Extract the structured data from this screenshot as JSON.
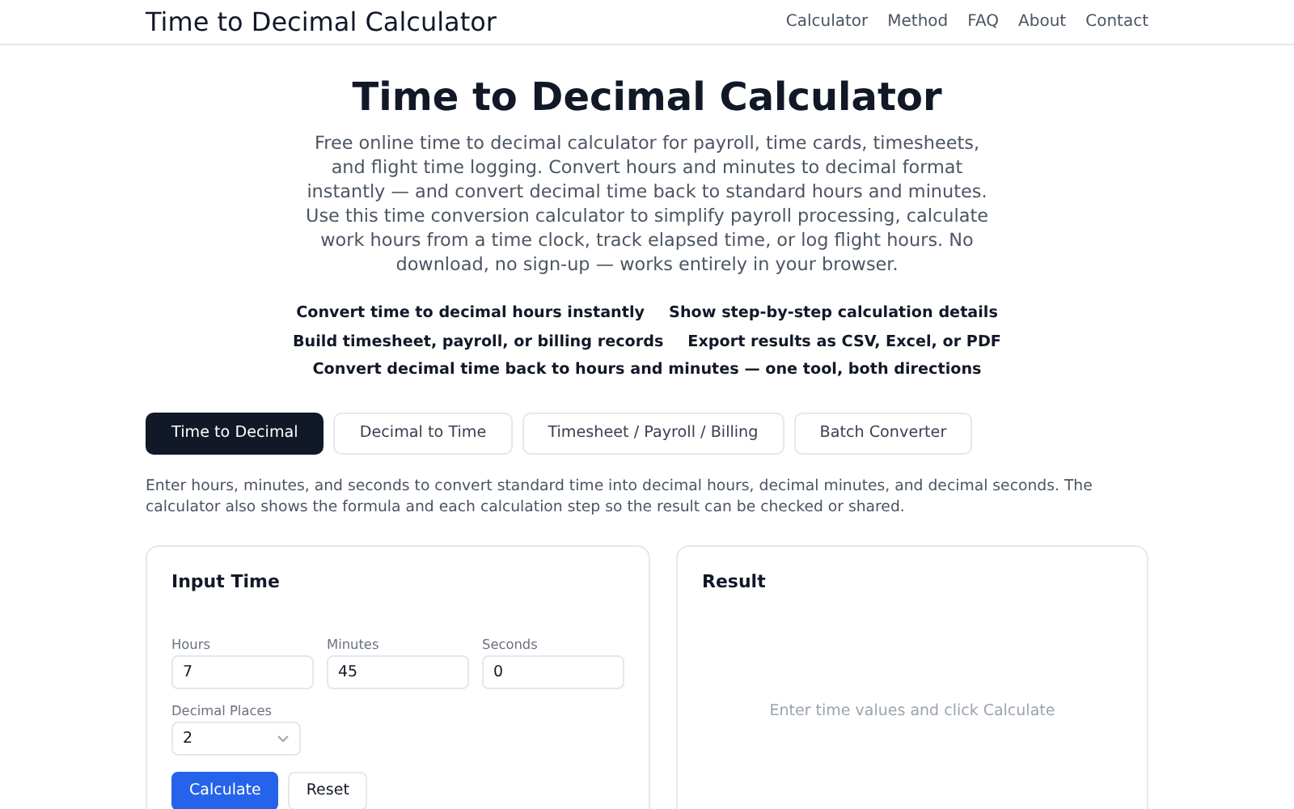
{
  "header": {
    "brand": "Time to Decimal Calculator",
    "nav": [
      "Calculator",
      "Method",
      "FAQ",
      "About",
      "Contact"
    ]
  },
  "hero": {
    "title": "Time to Decimal Calculator",
    "description": "Free online time to decimal calculator for payroll, time cards, timesheets, and flight time logging. Convert hours and minutes to decimal format instantly — and convert decimal time back to standard hours and minutes. Use this time conversion calculator to simplify payroll processing, calculate work hours from a time clock, track elapsed time, or log flight hours. No download, no sign-up — works entirely in your browser.",
    "features": [
      "Convert time to decimal hours instantly",
      "Show step-by-step calculation details",
      "Build timesheet, payroll, or billing records",
      "Export results as CSV, Excel, or PDF",
      "Convert decimal time back to hours and minutes — one tool, both directions"
    ]
  },
  "tabs": [
    {
      "label": "Time to Decimal",
      "selected": true
    },
    {
      "label": "Decimal to Time",
      "selected": false
    },
    {
      "label": "Timesheet / Payroll / Billing",
      "selected": false
    },
    {
      "label": "Batch Converter",
      "selected": false
    }
  ],
  "intro": "Enter hours, minutes, and seconds to convert standard time into decimal hours, decimal minutes, and decimal seconds. The calculator also shows the formula and each calculation step so the result can be checked or shared.",
  "input_card": {
    "title": "Input Time",
    "fields": [
      {
        "label": "Hours",
        "value": "7"
      },
      {
        "label": "Minutes",
        "value": "45"
      },
      {
        "label": "Seconds",
        "value": "0"
      }
    ],
    "decimal_places": {
      "label": "Decimal Places",
      "value": "2"
    },
    "buttons": [
      {
        "label": "Calculate",
        "kind": "primary"
      },
      {
        "label": "Reset",
        "kind": "secondary"
      }
    ]
  },
  "result_card": {
    "title": "Result",
    "empty_message": "Enter time values and click Calculate"
  }
}
